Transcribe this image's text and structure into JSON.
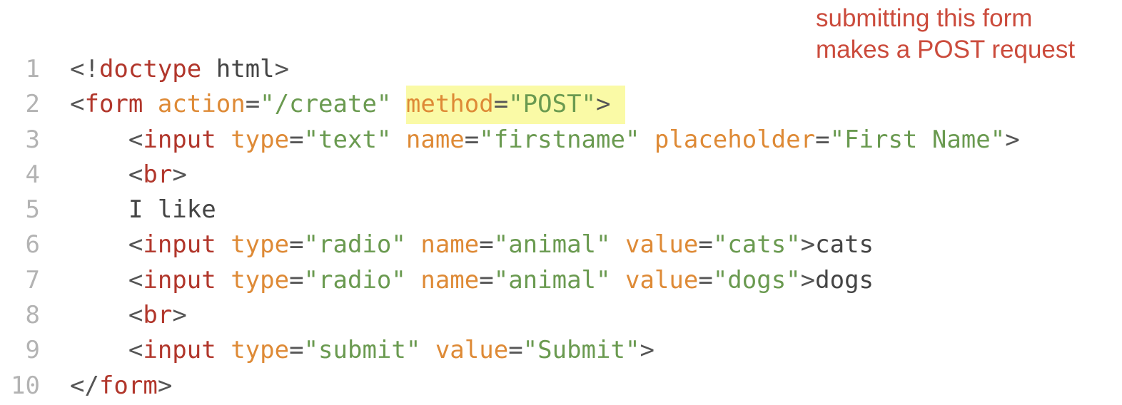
{
  "annotation": {
    "line1": "submitting this form",
    "line2": "makes a POST request"
  },
  "code": {
    "lines": [
      {
        "num": "1",
        "tokens": [
          {
            "k": "p",
            "v": "<!"
          },
          {
            "k": "t",
            "v": "doctype"
          },
          {
            "k": "x",
            "v": " html"
          },
          {
            "k": "p",
            "v": ">"
          }
        ]
      },
      {
        "num": "2",
        "tokens": [
          {
            "k": "p",
            "v": "<"
          },
          {
            "k": "t",
            "v": "form"
          },
          {
            "k": "p",
            "v": " "
          },
          {
            "k": "a",
            "v": "action"
          },
          {
            "k": "p",
            "v": "="
          },
          {
            "k": "s",
            "v": "\"/create\""
          },
          {
            "k": "p",
            "v": " "
          },
          {
            "k": "a",
            "v": "method",
            "hl": true
          },
          {
            "k": "p",
            "v": "=",
            "hl": true
          },
          {
            "k": "s",
            "v": "\"POST\"",
            "hl": true
          },
          {
            "k": "p",
            "v": ">",
            "hl": true
          }
        ]
      },
      {
        "num": "3",
        "tokens": [
          {
            "k": "p",
            "v": "    <"
          },
          {
            "k": "t",
            "v": "input"
          },
          {
            "k": "p",
            "v": " "
          },
          {
            "k": "a",
            "v": "type"
          },
          {
            "k": "p",
            "v": "="
          },
          {
            "k": "s",
            "v": "\"text\""
          },
          {
            "k": "p",
            "v": " "
          },
          {
            "k": "a",
            "v": "name"
          },
          {
            "k": "p",
            "v": "="
          },
          {
            "k": "s",
            "v": "\"firstname\""
          },
          {
            "k": "p",
            "v": " "
          },
          {
            "k": "a",
            "v": "placeholder"
          },
          {
            "k": "p",
            "v": "="
          },
          {
            "k": "s",
            "v": "\"First Name\""
          },
          {
            "k": "p",
            "v": ">"
          }
        ]
      },
      {
        "num": "4",
        "tokens": [
          {
            "k": "p",
            "v": "    <"
          },
          {
            "k": "t",
            "v": "br"
          },
          {
            "k": "p",
            "v": ">"
          }
        ]
      },
      {
        "num": "5",
        "tokens": [
          {
            "k": "x",
            "v": "    I like"
          }
        ]
      },
      {
        "num": "6",
        "tokens": [
          {
            "k": "p",
            "v": "    <"
          },
          {
            "k": "t",
            "v": "input"
          },
          {
            "k": "p",
            "v": " "
          },
          {
            "k": "a",
            "v": "type"
          },
          {
            "k": "p",
            "v": "="
          },
          {
            "k": "s",
            "v": "\"radio\""
          },
          {
            "k": "p",
            "v": " "
          },
          {
            "k": "a",
            "v": "name"
          },
          {
            "k": "p",
            "v": "="
          },
          {
            "k": "s",
            "v": "\"animal\""
          },
          {
            "k": "p",
            "v": " "
          },
          {
            "k": "a",
            "v": "value"
          },
          {
            "k": "p",
            "v": "="
          },
          {
            "k": "s",
            "v": "\"cats\""
          },
          {
            "k": "p",
            "v": ">"
          },
          {
            "k": "x",
            "v": "cats"
          }
        ]
      },
      {
        "num": "7",
        "tokens": [
          {
            "k": "p",
            "v": "    <"
          },
          {
            "k": "t",
            "v": "input"
          },
          {
            "k": "p",
            "v": " "
          },
          {
            "k": "a",
            "v": "type"
          },
          {
            "k": "p",
            "v": "="
          },
          {
            "k": "s",
            "v": "\"radio\""
          },
          {
            "k": "p",
            "v": " "
          },
          {
            "k": "a",
            "v": "name"
          },
          {
            "k": "p",
            "v": "="
          },
          {
            "k": "s",
            "v": "\"animal\""
          },
          {
            "k": "p",
            "v": " "
          },
          {
            "k": "a",
            "v": "value"
          },
          {
            "k": "p",
            "v": "="
          },
          {
            "k": "s",
            "v": "\"dogs\""
          },
          {
            "k": "p",
            "v": ">"
          },
          {
            "k": "x",
            "v": "dogs"
          }
        ]
      },
      {
        "num": "8",
        "tokens": [
          {
            "k": "p",
            "v": "    <"
          },
          {
            "k": "t",
            "v": "br"
          },
          {
            "k": "p",
            "v": ">"
          }
        ]
      },
      {
        "num": "9",
        "tokens": [
          {
            "k": "p",
            "v": "    <"
          },
          {
            "k": "t",
            "v": "input"
          },
          {
            "k": "p",
            "v": " "
          },
          {
            "k": "a",
            "v": "type"
          },
          {
            "k": "p",
            "v": "="
          },
          {
            "k": "s",
            "v": "\"submit\""
          },
          {
            "k": "p",
            "v": " "
          },
          {
            "k": "a",
            "v": "value"
          },
          {
            "k": "p",
            "v": "="
          },
          {
            "k": "s",
            "v": "\"Submit\""
          },
          {
            "k": "p",
            "v": ">"
          }
        ]
      },
      {
        "num": "10",
        "tokens": [
          {
            "k": "p",
            "v": "</"
          },
          {
            "k": "t",
            "v": "form"
          },
          {
            "k": "p",
            "v": ">"
          }
        ]
      }
    ]
  }
}
